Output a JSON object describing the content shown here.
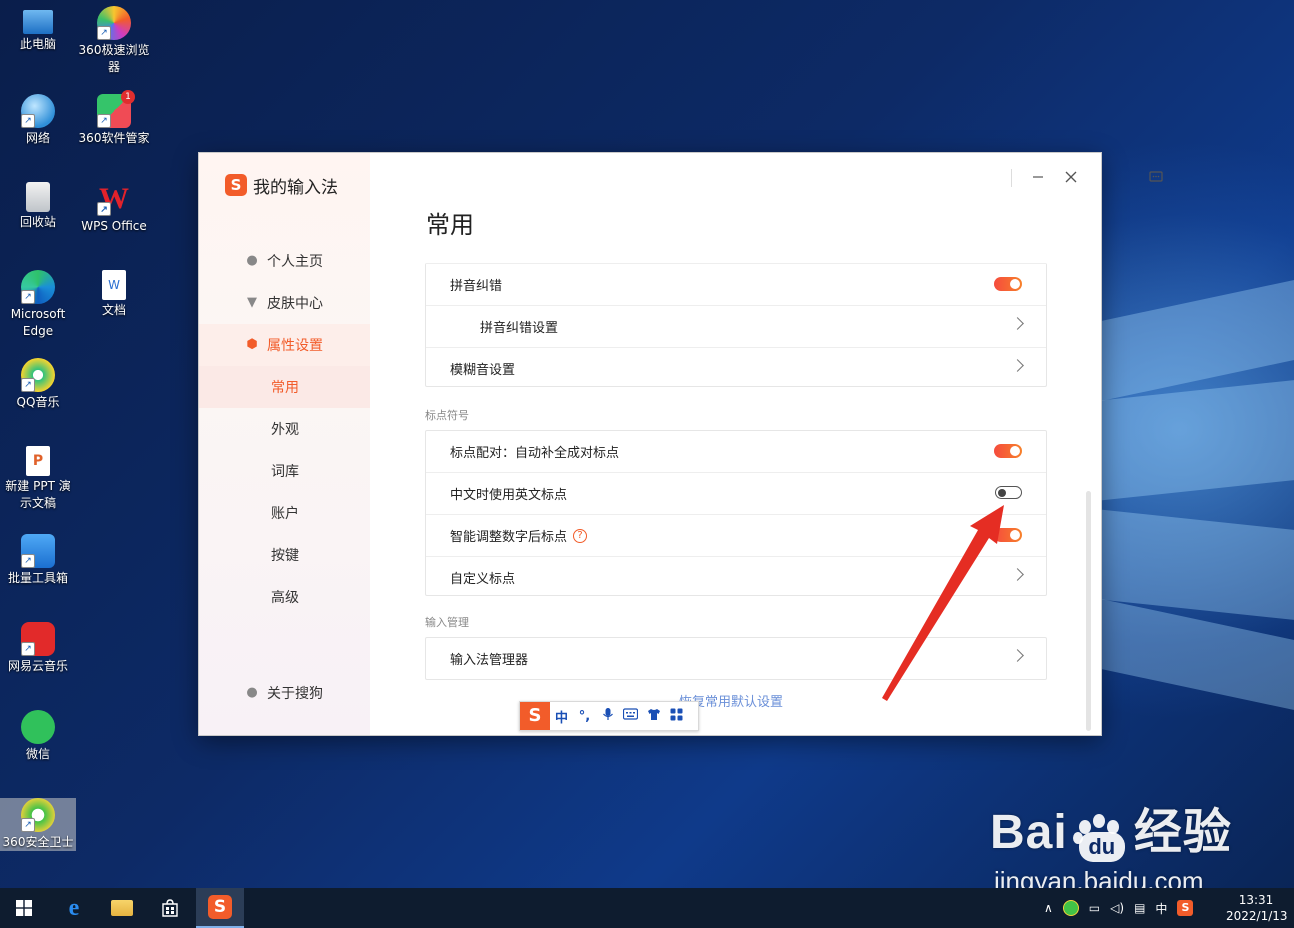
{
  "desktop": {
    "icons": [
      {
        "label": "此电脑"
      },
      {
        "label": "360极速浏览器"
      },
      {
        "label": "网络"
      },
      {
        "label": "360软件管家",
        "badge": "1"
      },
      {
        "label": "回收站"
      },
      {
        "label": "WPS Office"
      },
      {
        "label": "Microsoft Edge"
      },
      {
        "label": "文档"
      },
      {
        "label": "QQ音乐"
      },
      {
        "label": "新建 PPT 演示文稿"
      },
      {
        "label": "批量工具箱"
      },
      {
        "label": "网易云音乐"
      },
      {
        "label": "微信"
      },
      {
        "label": "360安全卫士"
      }
    ]
  },
  "window": {
    "brand": "我的输入法",
    "logo_letter": "S",
    "accent": "#f25c2a",
    "nav": [
      {
        "label": "个人主页",
        "icon": "user-icon"
      },
      {
        "label": "皮肤中心",
        "icon": "shirt-icon"
      },
      {
        "label": "属性设置",
        "icon": "hexagon-icon",
        "active": true
      },
      {
        "label": "常用",
        "sub": true,
        "selected": true
      },
      {
        "label": "外观",
        "sub": true
      },
      {
        "label": "词库",
        "sub": true
      },
      {
        "label": "账户",
        "sub": true
      },
      {
        "label": "按键",
        "sub": true
      },
      {
        "label": "高级",
        "sub": true
      }
    ],
    "about": "关于搜狗",
    "page_title": "常用",
    "group1": [
      {
        "label": "拼音纠错",
        "control": "toggle",
        "on": true
      },
      {
        "label": "拼音纠错设置",
        "control": "chevron",
        "indent": true
      },
      {
        "label": "模糊音设置",
        "control": "chevron"
      }
    ],
    "section_punct": "标点符号",
    "group2": [
      {
        "label": "标点配对：自动补全成对标点",
        "control": "toggle",
        "on": true
      },
      {
        "label": "中文时使用英文标点",
        "control": "toggle",
        "on": false
      },
      {
        "label": "智能调整数字后标点",
        "control": "toggle",
        "on": true,
        "help": "?"
      },
      {
        "label": "自定义标点",
        "control": "chevron"
      }
    ],
    "section_input": "输入管理",
    "group3": [
      {
        "label": "输入法管理器",
        "control": "chevron"
      }
    ],
    "restore_link": "恢复常用默认设置"
  },
  "ime_bar": {
    "logo": "S",
    "mode": "中",
    "punct": "°,"
  },
  "taskbar": {
    "tray_lang": "中",
    "time": "13:31",
    "date": "2022/1/13"
  },
  "watermark": {
    "big_left": "Bai",
    "big_mid": "du",
    "big_right": "经验",
    "url": "jingyan.baidu.com"
  }
}
